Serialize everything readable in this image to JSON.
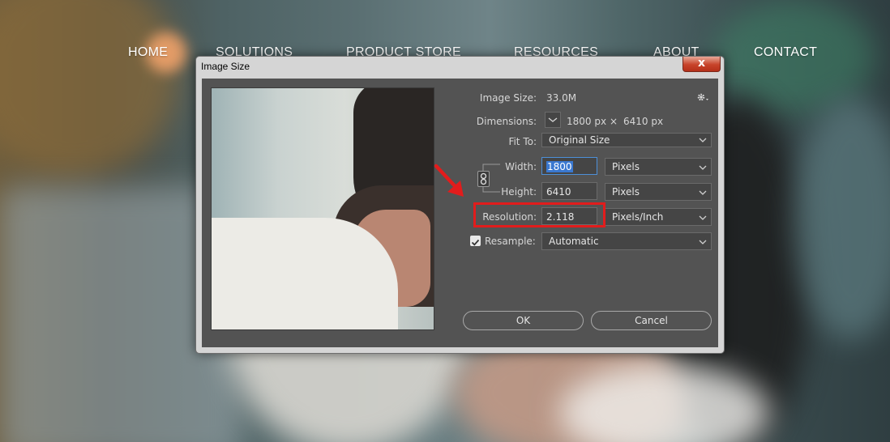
{
  "site_nav": {
    "items": [
      "HOME",
      "SOLUTIONS",
      "PRODUCT STORE",
      "RESOURCES",
      "ABOUT",
      "CONTACT"
    ]
  },
  "dialog": {
    "title": "Image Size",
    "close_label": "x",
    "image_size_label": "Image Size:",
    "image_size_value": "33.0M",
    "settings_icon": "gear-icon",
    "dimensions_label": "Dimensions:",
    "dimensions_width": "1800 px",
    "dimensions_times": "×",
    "dimensions_height": "6410 px",
    "fit_to_label": "Fit To:",
    "fit_to_value": "Original Size",
    "width_label": "Width:",
    "width_value": "1800",
    "width_unit": "Pixels",
    "height_label": "Height:",
    "height_value": "6410",
    "height_unit": "Pixels",
    "resolution_label": "Resolution:",
    "resolution_value": "2.118",
    "resolution_unit": "Pixels/Inch",
    "resample_label": "Resample:",
    "resample_checked": true,
    "resample_value": "Automatic",
    "ok_label": "OK",
    "cancel_label": "Cancel"
  },
  "colors": {
    "dialog_bg": "#535353",
    "highlight": "#e21c1c",
    "focus": "#4d8fd8"
  }
}
